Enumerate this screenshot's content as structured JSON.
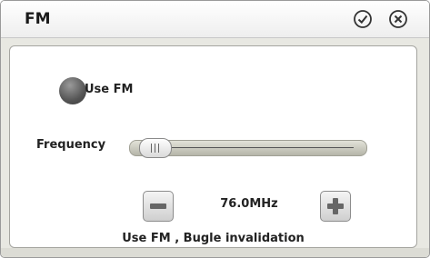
{
  "window": {
    "title": "FM"
  },
  "titlebar_buttons": {
    "confirm_icon": "check-circle-icon",
    "close_icon": "x-circle-icon"
  },
  "use_fm": {
    "label": "Use FM",
    "checked": false
  },
  "frequency": {
    "label": "Frequency",
    "slider_level_fraction": 0.0,
    "display": "76.0MHz"
  },
  "controls": {
    "decrease_icon": "minus-icon",
    "increase_icon": "plus-icon"
  },
  "status_text": "Use FM , Bugle invalidation",
  "colors": {
    "window_bg": "#e8e8e2",
    "content_bg": "#ffffff",
    "radio": "#555555"
  }
}
